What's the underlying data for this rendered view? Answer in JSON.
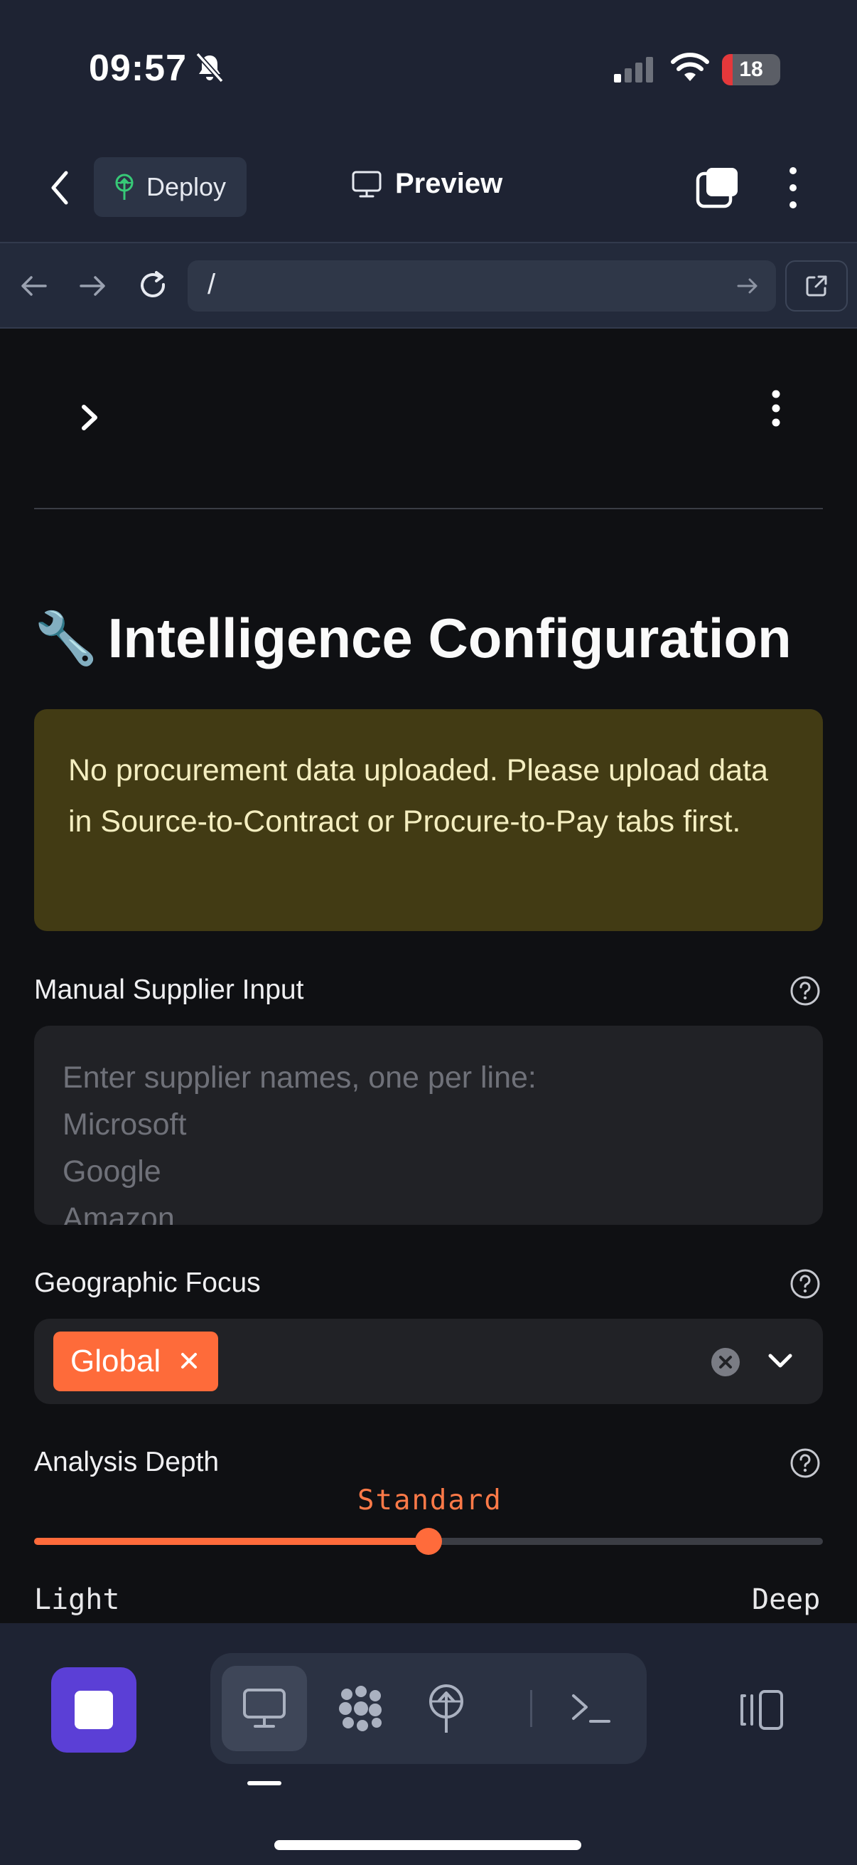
{
  "status_bar": {
    "time": "09:57",
    "battery": "18",
    "battery_level": 0.18
  },
  "header": {
    "deploy_label": "Deploy",
    "preview_label": "Preview"
  },
  "url_bar": {
    "path": "/"
  },
  "page": {
    "title_emoji": "🔧",
    "title": "Intelligence Configuration",
    "warning": "No procurement data uploaded. Please upload data in Source-to-Contract or Procure-to-Pay tabs first.",
    "supplier_input": {
      "label": "Manual Supplier Input",
      "placeholder": "Enter supplier names, one per line:\nMicrosoft\nGoogle\nAmazon"
    },
    "geo_focus": {
      "label": "Geographic Focus",
      "selected": [
        "Global"
      ]
    },
    "analysis_depth": {
      "label": "Analysis Depth",
      "value": "Standard",
      "min_label": "Light",
      "max_label": "Deep",
      "position": 0.5
    }
  },
  "colors": {
    "accent": "#ff6b3b",
    "warning_bg": "#423b14",
    "stop_button": "#5b3fd6"
  }
}
